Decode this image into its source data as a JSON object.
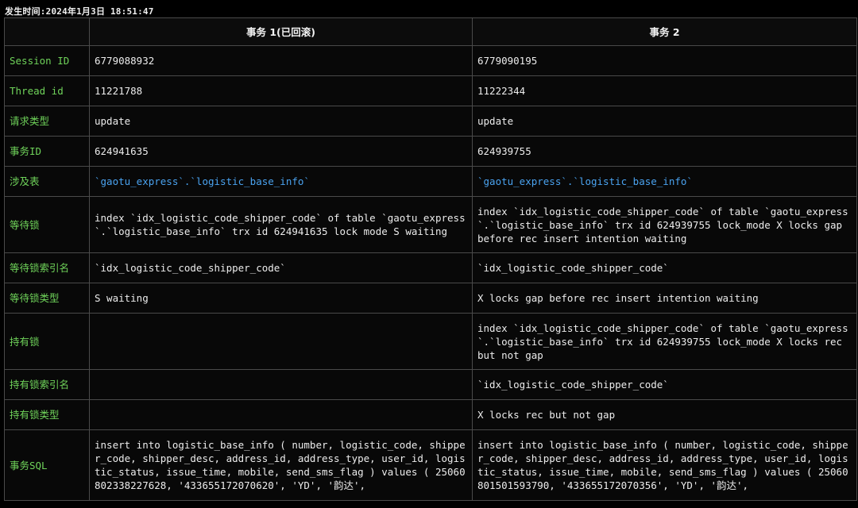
{
  "timestamp": "发生时间:2024年1月3日 18:51:47",
  "header": {
    "col1": "事务 1(已回滚)",
    "col2": "事务 2"
  },
  "rows": [
    {
      "label": "Session ID",
      "tx1": "6779088932",
      "tx2": "6779090195",
      "kind": "text"
    },
    {
      "label": "Thread id",
      "tx1": "11221788",
      "tx2": "11222344",
      "kind": "text"
    },
    {
      "label": "请求类型",
      "tx1": "update",
      "tx2": "update",
      "kind": "text"
    },
    {
      "label": "事务ID",
      "tx1": "624941635",
      "tx2": "624939755",
      "kind": "text"
    },
    {
      "label": "涉及表",
      "tx1": "`gaotu_express`.`logistic_base_info`",
      "tx2": "`gaotu_express`.`logistic_base_info`",
      "kind": "table-ref"
    },
    {
      "label": "等待锁",
      "tx1": "index `idx_logistic_code_shipper_code` of table `gaotu_express`.`logistic_base_info` trx id 624941635 lock mode S waiting",
      "tx2": "index `idx_logistic_code_shipper_code` of table `gaotu_express`.`logistic_base_info` trx id 624939755 lock_mode X locks gap before rec insert intention waiting",
      "kind": "text"
    },
    {
      "label": "等待锁索引名",
      "tx1": "`idx_logistic_code_shipper_code`",
      "tx2": "`idx_logistic_code_shipper_code`",
      "kind": "text"
    },
    {
      "label": "等待锁类型",
      "tx1": "S waiting",
      "tx2": "X locks gap before rec insert intention waiting",
      "kind": "text"
    },
    {
      "label": "持有锁",
      "tx1": "",
      "tx2": "index `idx_logistic_code_shipper_code` of table `gaotu_express`.`logistic_base_info` trx id 624939755 lock_mode X locks rec but not gap",
      "kind": "text"
    },
    {
      "label": "持有锁索引名",
      "tx1": "",
      "tx2": "`idx_logistic_code_shipper_code`",
      "kind": "text"
    },
    {
      "label": "持有锁类型",
      "tx1": "",
      "tx2": "X locks rec but not gap",
      "kind": "text"
    },
    {
      "label": "事务SQL",
      "tx1": "insert into logistic_base_info ( number, logistic_code, shipper_code, shipper_desc, address_id, address_type, user_id, logistic_status, issue_time, mobile, send_sms_flag ) values ( 25060802338227628, '433655172070620', 'YD', '韵达',",
      "tx2": "insert into logistic_base_info ( number, logistic_code, shipper_code, shipper_desc, address_id, address_type, user_id, logistic_status, issue_time, mobile, send_sms_flag ) values ( 25060801501593790, '433655172070356', 'YD', '韵达',",
      "kind": "text"
    }
  ],
  "colors": {
    "label": "#6fd35a",
    "table_ref": "#4aa3f0",
    "background": "#000000",
    "border": "#4a4a4a"
  }
}
